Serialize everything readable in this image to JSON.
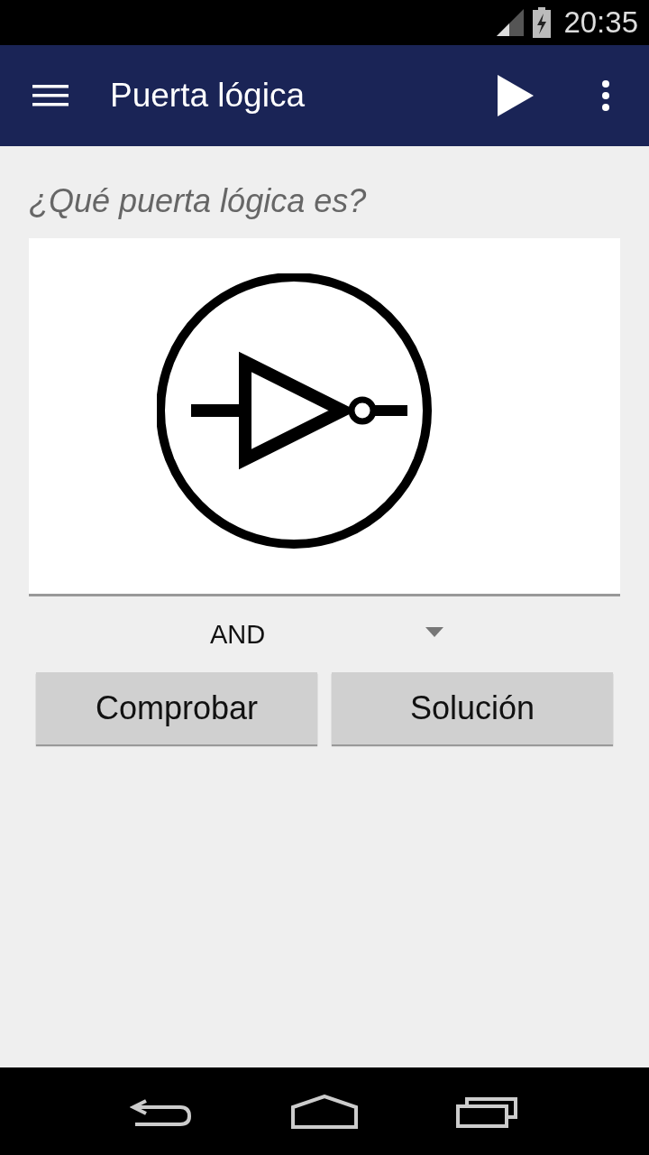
{
  "status_bar": {
    "time": "20:35"
  },
  "app_bar": {
    "title": "Puerta lógica"
  },
  "question": "¿Qué puerta lógica es?",
  "answer_dropdown": {
    "value": "AND"
  },
  "buttons": [
    "Comprobar",
    "Solución"
  ]
}
